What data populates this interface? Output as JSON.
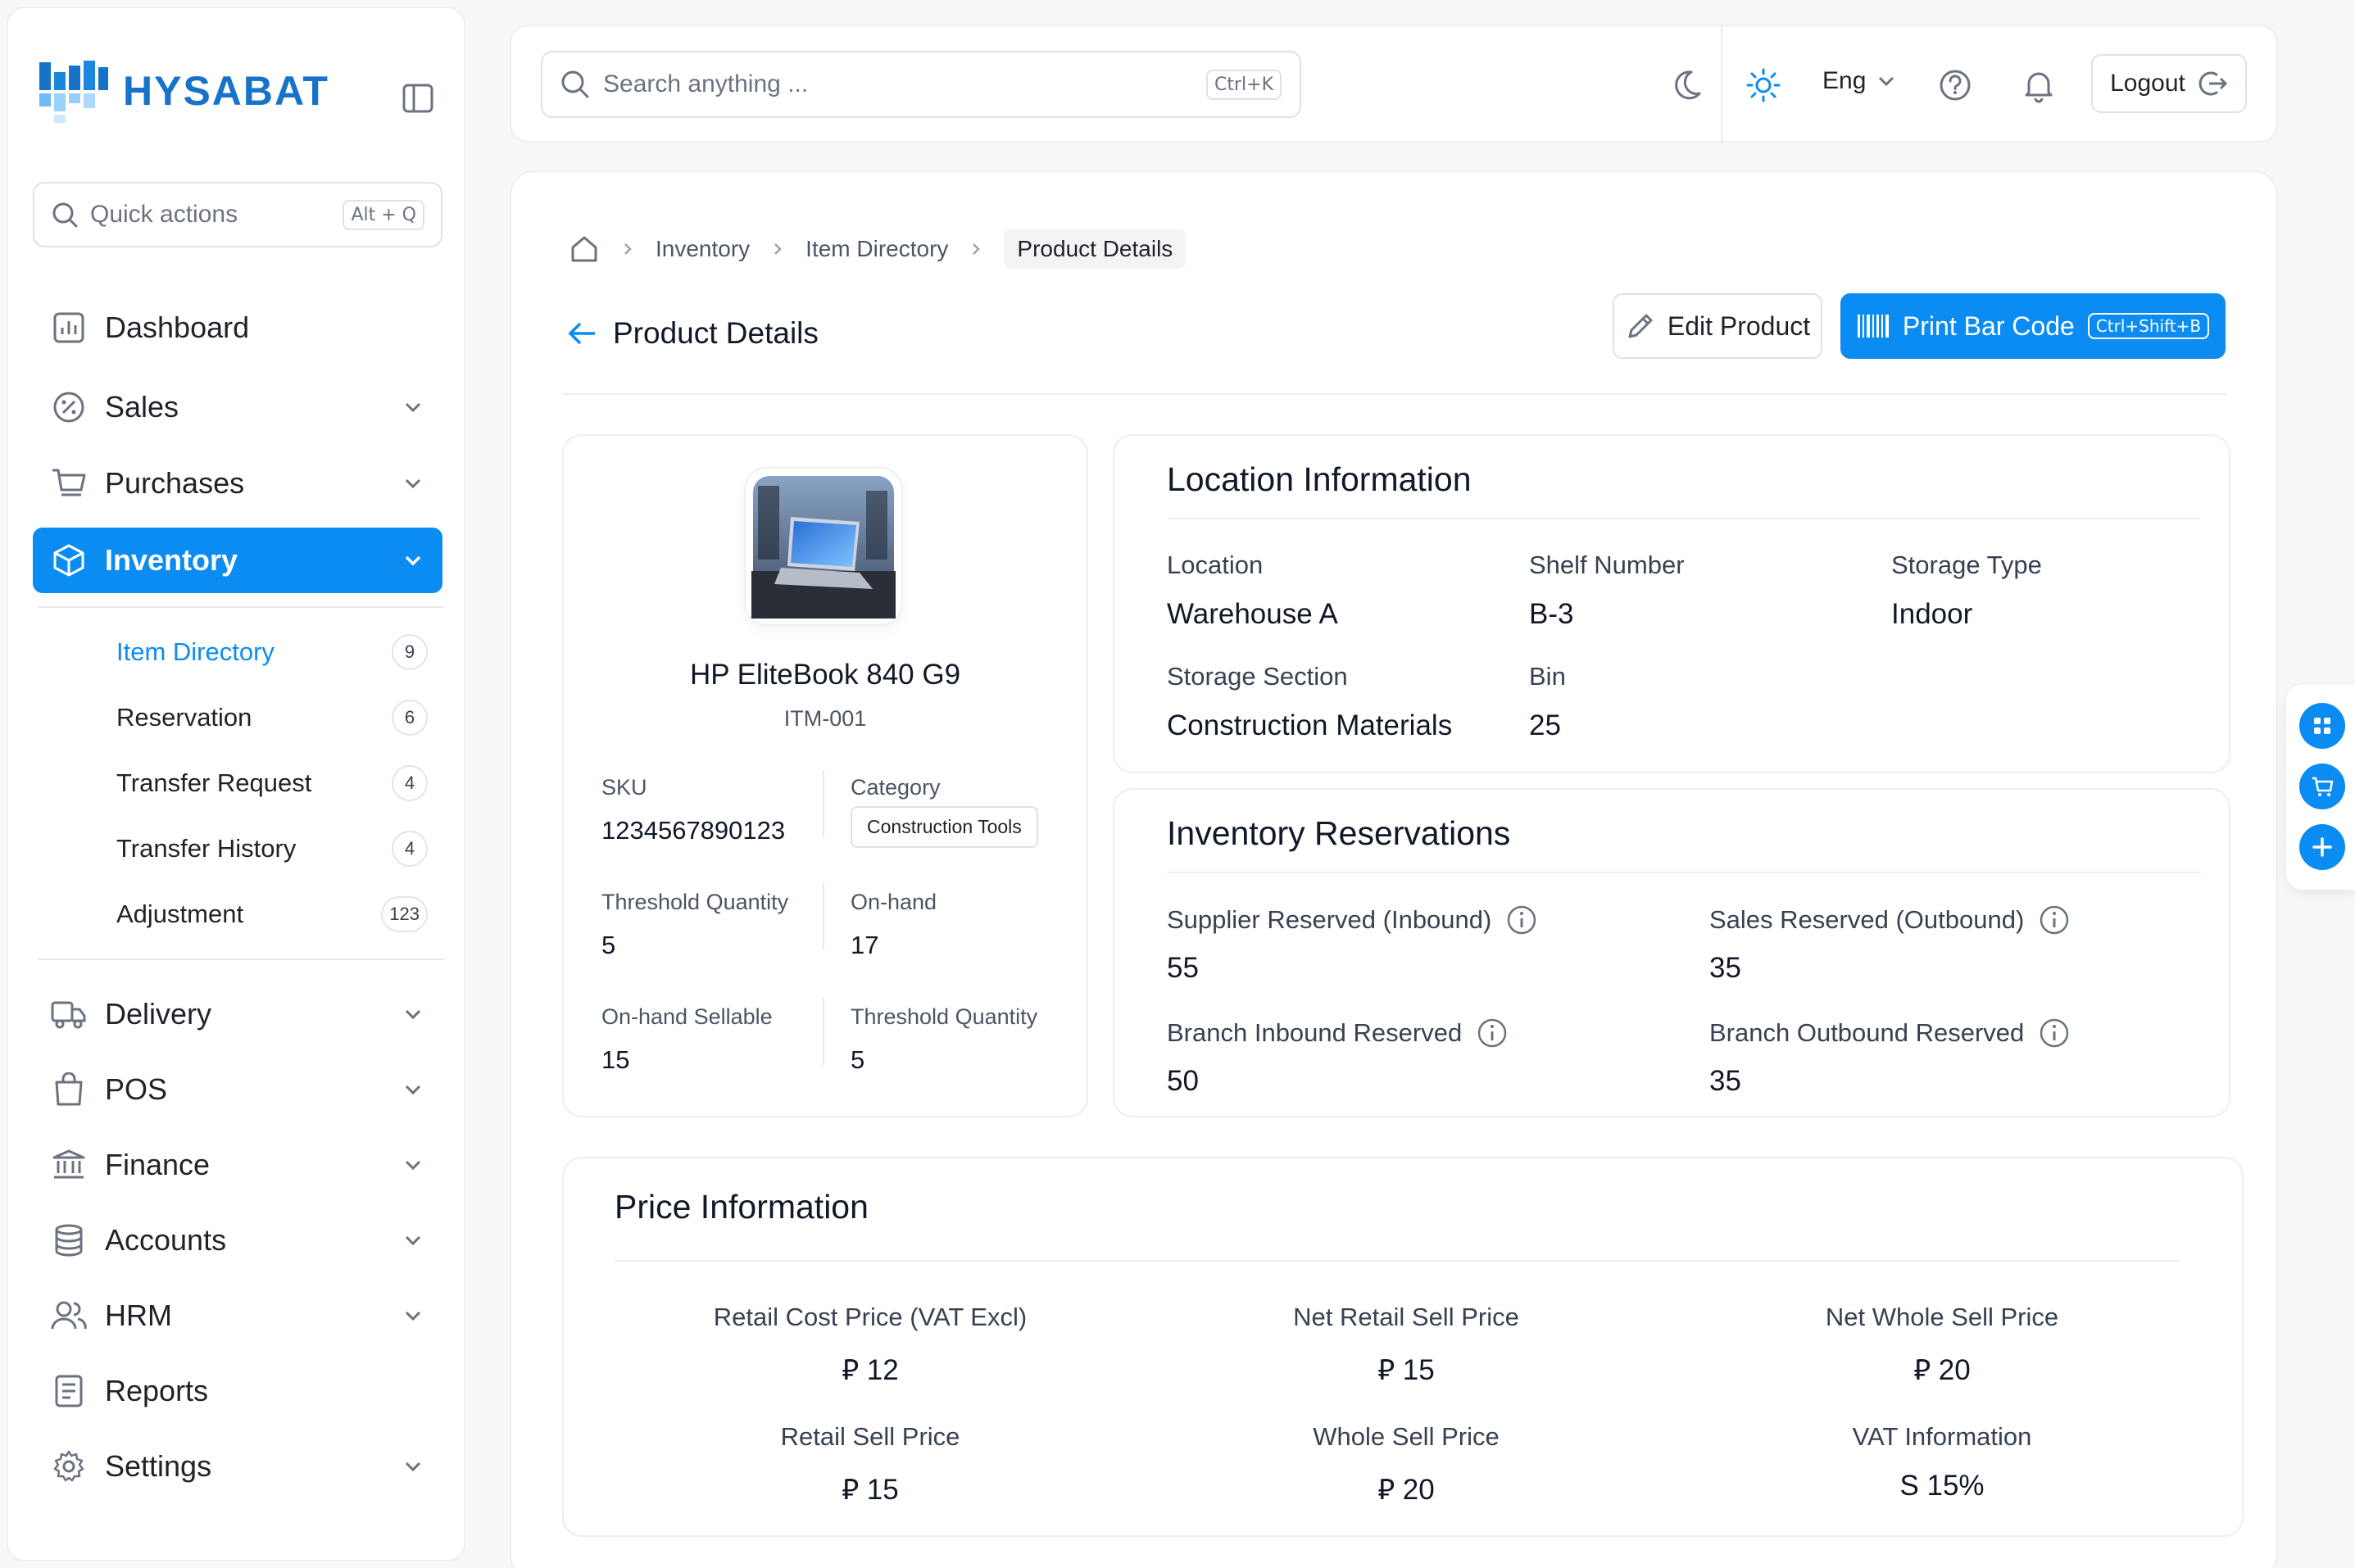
{
  "brand": {
    "name": "HYSABAT",
    "accent": "#0b8cf3",
    "logo_color": "#1673c9"
  },
  "sidebar": {
    "quick_actions": {
      "placeholder": "Quick actions",
      "shortcut": "Alt + Q"
    },
    "items": [
      {
        "label": "Dashboard",
        "icon": "dashboard-icon"
      },
      {
        "label": "Sales",
        "icon": "percent-icon"
      },
      {
        "label": "Purchases",
        "icon": "cart-icon"
      },
      {
        "label": "Inventory",
        "icon": "box-icon",
        "active": true
      },
      {
        "label": "Delivery",
        "icon": "truck-icon"
      },
      {
        "label": "POS",
        "icon": "shopping-bag-icon"
      },
      {
        "label": "Finance",
        "icon": "bank-icon"
      },
      {
        "label": "Accounts",
        "icon": "database-icon"
      },
      {
        "label": "HRM",
        "icon": "users-icon"
      },
      {
        "label": "Reports",
        "icon": "document-icon"
      },
      {
        "label": "Settings",
        "icon": "gear-icon"
      }
    ],
    "inventory_sub": [
      {
        "label": "Item Directory",
        "count": "9",
        "active": true
      },
      {
        "label": "Reservation",
        "count": "6"
      },
      {
        "label": "Transfer Request",
        "count": "4"
      },
      {
        "label": "Transfer History",
        "count": "4"
      },
      {
        "label": "Adjustment",
        "count": "123"
      }
    ]
  },
  "topbar": {
    "search": {
      "placeholder": "Search anything ...",
      "shortcut": "Ctrl+K"
    },
    "language": "Eng",
    "logout": "Logout"
  },
  "breadcrumb": [
    "Inventory",
    "Item Directory",
    "Product Details"
  ],
  "page": {
    "title": "Product Details",
    "edit_button": "Edit Product",
    "print_button": "Print Bar Code",
    "print_shortcut": "Ctrl+Shift+B"
  },
  "product": {
    "name": "HP EliteBook 840 G9",
    "code": "ITM-001",
    "fields": {
      "sku_label": "SKU",
      "sku": "1234567890123",
      "category_label": "Category",
      "category": "Construction Tools",
      "threshold_label": "Threshold Quantity",
      "threshold": "5",
      "onhand_label": "On-hand",
      "onhand": "17",
      "sellable_label": "On-hand Sellable",
      "sellable": "15",
      "threshold2_label": "Threshold Quantity",
      "threshold2": "5"
    }
  },
  "location": {
    "title": "Location Information",
    "location_label": "Location",
    "location": "Warehouse A",
    "shelf_label": "Shelf Number",
    "shelf": "B-3",
    "storage_type_label": "Storage Type",
    "storage_type": "Indoor",
    "section_label": "Storage Section",
    "section": "Construction Materials",
    "bin_label": "Bin",
    "bin": "25"
  },
  "reservations": {
    "title": "Inventory Reservations",
    "supplier_label": "Supplier Reserved (Inbound)",
    "supplier": "55",
    "sales_label": "Sales Reserved (Outbound)",
    "sales": "35",
    "branch_in_label": "Branch Inbound Reserved",
    "branch_in": "50",
    "branch_out_label": "Branch Outbound Reserved",
    "branch_out": "35"
  },
  "price": {
    "title": "Price Information",
    "items": [
      {
        "label": "Retail Cost Price (VAT Excl)",
        "value": "⃁ 12"
      },
      {
        "label": "Net Retail Sell Price",
        "value": "⃁ 15"
      },
      {
        "label": "Net Whole Sell Price",
        "value": "⃁ 20"
      },
      {
        "label": "Retail Sell Price",
        "value": "⃁ 15"
      },
      {
        "label": "Whole Sell Price",
        "value": "⃁ 20"
      },
      {
        "label": "VAT Information",
        "value": "S 15%"
      }
    ]
  }
}
